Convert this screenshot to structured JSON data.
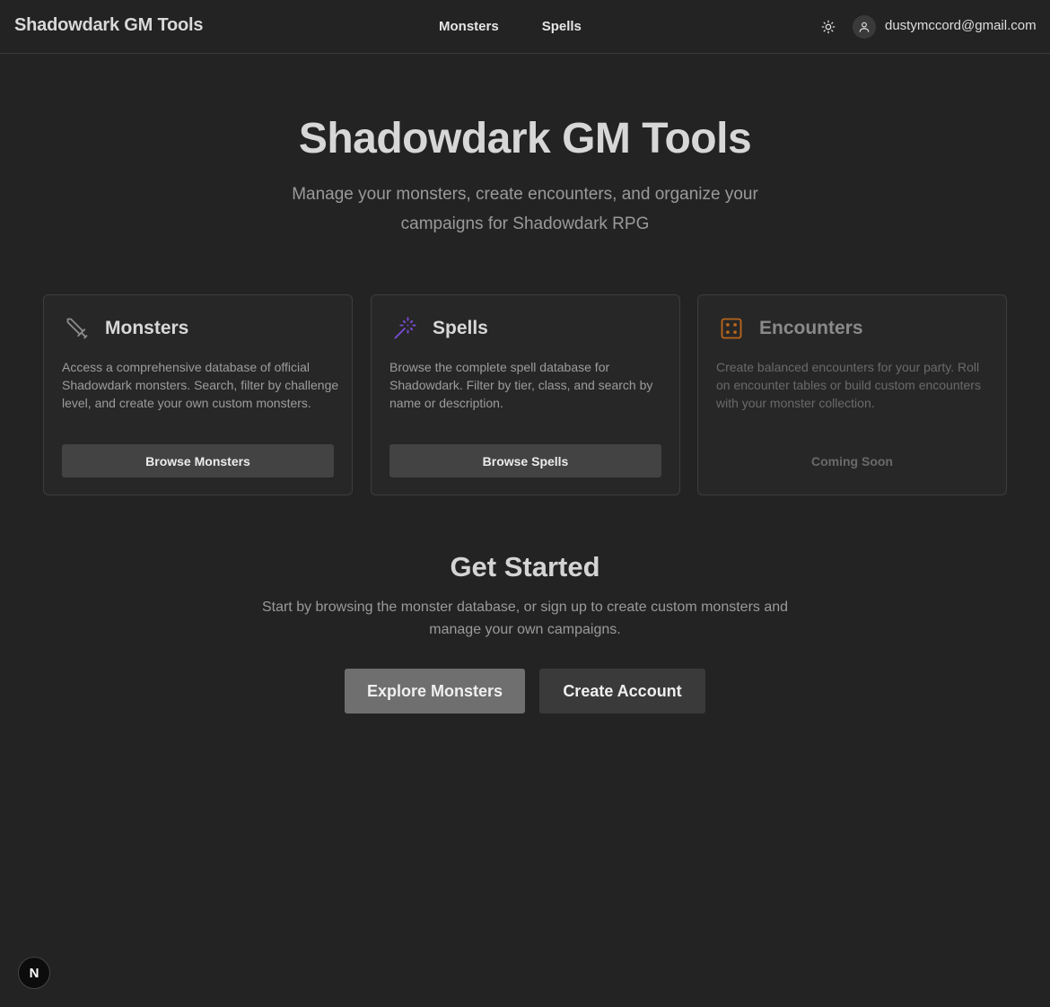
{
  "header": {
    "brand": "Shadowdark GM Tools",
    "nav": [
      "Monsters",
      "Spells"
    ],
    "theme_icon": "sun-icon",
    "user_icon": "user-icon",
    "user_email": "dustymccord@gmail.com"
  },
  "hero": {
    "title": "Shadowdark GM Tools",
    "subtitle": "Manage your monsters, create encounters, and organize your campaigns for Shadowdark RPG"
  },
  "cards": [
    {
      "icon": "sword-icon",
      "icon_color": "#8a8a8a",
      "title": "Monsters",
      "description": "Access a comprehensive database of official Shadowdark monsters. Search, filter by challenge level, and create your own custom monsters.",
      "action": "Browse Monsters"
    },
    {
      "icon": "magic-wand-icon",
      "icon_color": "#7c4dd8",
      "title": "Spells",
      "description": "Browse the complete spell database for Shadowdark. Filter by tier, class, and search by name or description.",
      "action": "Browse Spells"
    },
    {
      "icon": "dice-icon",
      "icon_color": "#b8651c",
      "title": "Encounters",
      "description": "Create balanced encounters for your party. Roll on encounter tables or build custom encounters with your monster collection.",
      "action": "Coming Soon"
    }
  ],
  "get_started": {
    "title": "Get Started",
    "subtitle": "Start by browsing the monster database, or sign up to create custom monsters and manage your own campaigns.",
    "primary": "Explore Monsters",
    "secondary": "Create Account"
  },
  "dev_badge": {
    "icon": "nextjs-icon",
    "label": "N"
  }
}
